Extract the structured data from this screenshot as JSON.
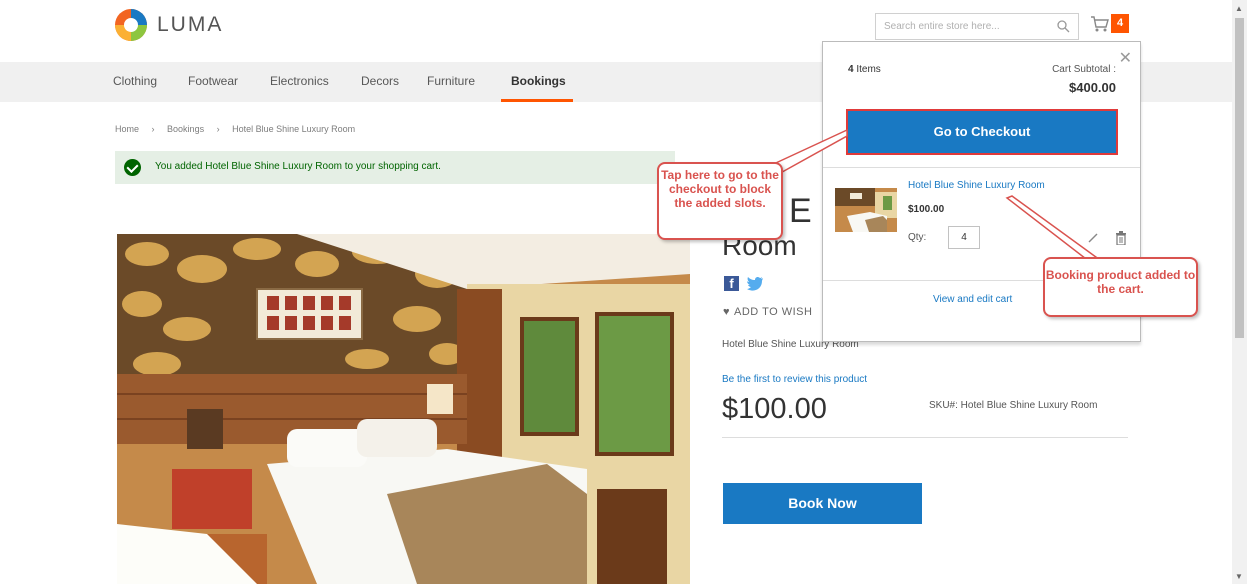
{
  "header": {
    "logo_text": "LUMA",
    "search_placeholder": "Search entire store here...",
    "cart_count": "4"
  },
  "nav": {
    "items": [
      {
        "label": "Clothing"
      },
      {
        "label": "Footwear"
      },
      {
        "label": "Electronics"
      },
      {
        "label": "Decors"
      },
      {
        "label": "Furniture"
      },
      {
        "label": "Bookings"
      }
    ],
    "active": "Bookings"
  },
  "breadcrumb": [
    "Home",
    "›",
    "Bookings",
    "›",
    "Hotel Blue Shine Luxury Room"
  ],
  "message": "You added Hotel Blue Shine Luxury Room to your shopping cart.",
  "product": {
    "title_line1": "l E",
    "title_line2": "Room",
    "wishlist": "ADD TO WISH",
    "short_name": "Hotel Blue Shine Luxury Room",
    "review_link": "Be the first to review this product",
    "price": "$100.00",
    "sku": "SKU#:  Hotel Blue Shine Luxury Room",
    "book_button": "Book Now"
  },
  "minicart": {
    "items_count": "4",
    "items_label": "Items",
    "subtotal_label": "Cart Subtotal :",
    "subtotal": "$400.00",
    "checkout_button": "Go to Checkout",
    "item": {
      "name": "Hotel Blue Shine Luxury Room",
      "price": "$100.00",
      "qty_label": "Qty:",
      "qty": "4"
    },
    "view_edit": "View and edit cart"
  },
  "annotations": {
    "checkout_note": "Tap here to go to the checkout to block the added slots.",
    "product_note": "Booking product added to the cart."
  },
  "colors": {
    "accent": "#ff5501",
    "primary_button": "#1979c3",
    "annotation": "#d9534f",
    "success_bg": "#e5efe5"
  }
}
